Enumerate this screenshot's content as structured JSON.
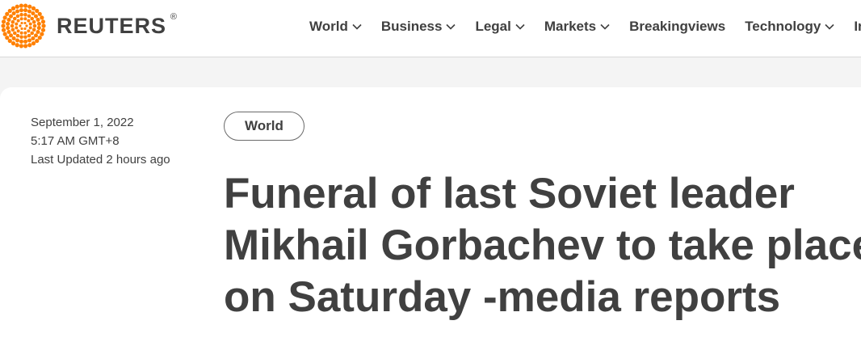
{
  "header": {
    "logo_text": "REUTERS",
    "logo_registered": "®",
    "nav": [
      {
        "label": "World",
        "dropdown": true
      },
      {
        "label": "Business",
        "dropdown": true
      },
      {
        "label": "Legal",
        "dropdown": true
      },
      {
        "label": "Markets",
        "dropdown": true
      },
      {
        "label": "Breakingviews",
        "dropdown": false
      },
      {
        "label": "Technology",
        "dropdown": true
      },
      {
        "label": "In",
        "dropdown": false
      }
    ]
  },
  "article": {
    "date": "September 1, 2022",
    "time": "5:17 AM GMT+8",
    "updated": "Last Updated 2 hours ago",
    "section_pill": "World",
    "headline_lines": [
      "Funeral of last Soviet leader",
      "Mikhail Gorbachev to take place",
      "on Saturday -media reports"
    ]
  },
  "colors": {
    "brand_orange": "#ff8000",
    "text": "#404040",
    "background_band": "#f4f4f4"
  },
  "icons": {
    "logo": "reuters-dot-logo-icon",
    "dropdown": "chevron-down-icon"
  }
}
